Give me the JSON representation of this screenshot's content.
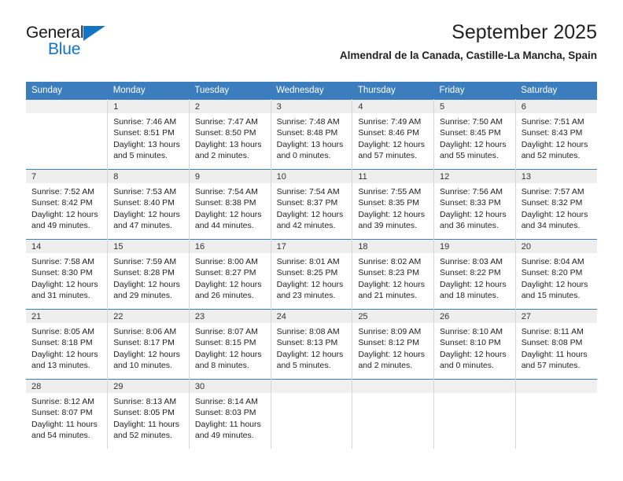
{
  "brand": {
    "line1": "General",
    "line2": "Blue",
    "triangle_icon": "triangle-icon",
    "colors": {
      "accent": "#1275c4"
    }
  },
  "header": {
    "title": "September 2025",
    "subtitle": "Almendral de la Canada, Castille-La Mancha, Spain"
  },
  "colors": {
    "header_bg": "#3b7dbd",
    "header_text": "#ffffff",
    "date_strip_bg": "#eeeeee",
    "cell_bg": "#ffffff",
    "rule": "#3b7dbd"
  },
  "calendar": {
    "weekday_headers": [
      "Sunday",
      "Monday",
      "Tuesday",
      "Wednesday",
      "Thursday",
      "Friday",
      "Saturday"
    ],
    "weeks": [
      [
        {
          "date": "",
          "sunrise": "",
          "sunset": "",
          "daylight_line1": "",
          "daylight_line2": ""
        },
        {
          "date": "1",
          "sunrise": "Sunrise: 7:46 AM",
          "sunset": "Sunset: 8:51 PM",
          "daylight_line1": "Daylight: 13 hours",
          "daylight_line2": "and 5 minutes."
        },
        {
          "date": "2",
          "sunrise": "Sunrise: 7:47 AM",
          "sunset": "Sunset: 8:50 PM",
          "daylight_line1": "Daylight: 13 hours",
          "daylight_line2": "and 2 minutes."
        },
        {
          "date": "3",
          "sunrise": "Sunrise: 7:48 AM",
          "sunset": "Sunset: 8:48 PM",
          "daylight_line1": "Daylight: 13 hours",
          "daylight_line2": "and 0 minutes."
        },
        {
          "date": "4",
          "sunrise": "Sunrise: 7:49 AM",
          "sunset": "Sunset: 8:46 PM",
          "daylight_line1": "Daylight: 12 hours",
          "daylight_line2": "and 57 minutes."
        },
        {
          "date": "5",
          "sunrise": "Sunrise: 7:50 AM",
          "sunset": "Sunset: 8:45 PM",
          "daylight_line1": "Daylight: 12 hours",
          "daylight_line2": "and 55 minutes."
        },
        {
          "date": "6",
          "sunrise": "Sunrise: 7:51 AM",
          "sunset": "Sunset: 8:43 PM",
          "daylight_line1": "Daylight: 12 hours",
          "daylight_line2": "and 52 minutes."
        }
      ],
      [
        {
          "date": "7",
          "sunrise": "Sunrise: 7:52 AM",
          "sunset": "Sunset: 8:42 PM",
          "daylight_line1": "Daylight: 12 hours",
          "daylight_line2": "and 49 minutes."
        },
        {
          "date": "8",
          "sunrise": "Sunrise: 7:53 AM",
          "sunset": "Sunset: 8:40 PM",
          "daylight_line1": "Daylight: 12 hours",
          "daylight_line2": "and 47 minutes."
        },
        {
          "date": "9",
          "sunrise": "Sunrise: 7:54 AM",
          "sunset": "Sunset: 8:38 PM",
          "daylight_line1": "Daylight: 12 hours",
          "daylight_line2": "and 44 minutes."
        },
        {
          "date": "10",
          "sunrise": "Sunrise: 7:54 AM",
          "sunset": "Sunset: 8:37 PM",
          "daylight_line1": "Daylight: 12 hours",
          "daylight_line2": "and 42 minutes."
        },
        {
          "date": "11",
          "sunrise": "Sunrise: 7:55 AM",
          "sunset": "Sunset: 8:35 PM",
          "daylight_line1": "Daylight: 12 hours",
          "daylight_line2": "and 39 minutes."
        },
        {
          "date": "12",
          "sunrise": "Sunrise: 7:56 AM",
          "sunset": "Sunset: 8:33 PM",
          "daylight_line1": "Daylight: 12 hours",
          "daylight_line2": "and 36 minutes."
        },
        {
          "date": "13",
          "sunrise": "Sunrise: 7:57 AM",
          "sunset": "Sunset: 8:32 PM",
          "daylight_line1": "Daylight: 12 hours",
          "daylight_line2": "and 34 minutes."
        }
      ],
      [
        {
          "date": "14",
          "sunrise": "Sunrise: 7:58 AM",
          "sunset": "Sunset: 8:30 PM",
          "daylight_line1": "Daylight: 12 hours",
          "daylight_line2": "and 31 minutes."
        },
        {
          "date": "15",
          "sunrise": "Sunrise: 7:59 AM",
          "sunset": "Sunset: 8:28 PM",
          "daylight_line1": "Daylight: 12 hours",
          "daylight_line2": "and 29 minutes."
        },
        {
          "date": "16",
          "sunrise": "Sunrise: 8:00 AM",
          "sunset": "Sunset: 8:27 PM",
          "daylight_line1": "Daylight: 12 hours",
          "daylight_line2": "and 26 minutes."
        },
        {
          "date": "17",
          "sunrise": "Sunrise: 8:01 AM",
          "sunset": "Sunset: 8:25 PM",
          "daylight_line1": "Daylight: 12 hours",
          "daylight_line2": "and 23 minutes."
        },
        {
          "date": "18",
          "sunrise": "Sunrise: 8:02 AM",
          "sunset": "Sunset: 8:23 PM",
          "daylight_line1": "Daylight: 12 hours",
          "daylight_line2": "and 21 minutes."
        },
        {
          "date": "19",
          "sunrise": "Sunrise: 8:03 AM",
          "sunset": "Sunset: 8:22 PM",
          "daylight_line1": "Daylight: 12 hours",
          "daylight_line2": "and 18 minutes."
        },
        {
          "date": "20",
          "sunrise": "Sunrise: 8:04 AM",
          "sunset": "Sunset: 8:20 PM",
          "daylight_line1": "Daylight: 12 hours",
          "daylight_line2": "and 15 minutes."
        }
      ],
      [
        {
          "date": "21",
          "sunrise": "Sunrise: 8:05 AM",
          "sunset": "Sunset: 8:18 PM",
          "daylight_line1": "Daylight: 12 hours",
          "daylight_line2": "and 13 minutes."
        },
        {
          "date": "22",
          "sunrise": "Sunrise: 8:06 AM",
          "sunset": "Sunset: 8:17 PM",
          "daylight_line1": "Daylight: 12 hours",
          "daylight_line2": "and 10 minutes."
        },
        {
          "date": "23",
          "sunrise": "Sunrise: 8:07 AM",
          "sunset": "Sunset: 8:15 PM",
          "daylight_line1": "Daylight: 12 hours",
          "daylight_line2": "and 8 minutes."
        },
        {
          "date": "24",
          "sunrise": "Sunrise: 8:08 AM",
          "sunset": "Sunset: 8:13 PM",
          "daylight_line1": "Daylight: 12 hours",
          "daylight_line2": "and 5 minutes."
        },
        {
          "date": "25",
          "sunrise": "Sunrise: 8:09 AM",
          "sunset": "Sunset: 8:12 PM",
          "daylight_line1": "Daylight: 12 hours",
          "daylight_line2": "and 2 minutes."
        },
        {
          "date": "26",
          "sunrise": "Sunrise: 8:10 AM",
          "sunset": "Sunset: 8:10 PM",
          "daylight_line1": "Daylight: 12 hours",
          "daylight_line2": "and 0 minutes."
        },
        {
          "date": "27",
          "sunrise": "Sunrise: 8:11 AM",
          "sunset": "Sunset: 8:08 PM",
          "daylight_line1": "Daylight: 11 hours",
          "daylight_line2": "and 57 minutes."
        }
      ],
      [
        {
          "date": "28",
          "sunrise": "Sunrise: 8:12 AM",
          "sunset": "Sunset: 8:07 PM",
          "daylight_line1": "Daylight: 11 hours",
          "daylight_line2": "and 54 minutes."
        },
        {
          "date": "29",
          "sunrise": "Sunrise: 8:13 AM",
          "sunset": "Sunset: 8:05 PM",
          "daylight_line1": "Daylight: 11 hours",
          "daylight_line2": "and 52 minutes."
        },
        {
          "date": "30",
          "sunrise": "Sunrise: 8:14 AM",
          "sunset": "Sunset: 8:03 PM",
          "daylight_line1": "Daylight: 11 hours",
          "daylight_line2": "and 49 minutes."
        },
        {
          "date": "",
          "sunrise": "",
          "sunset": "",
          "daylight_line1": "",
          "daylight_line2": ""
        },
        {
          "date": "",
          "sunrise": "",
          "sunset": "",
          "daylight_line1": "",
          "daylight_line2": ""
        },
        {
          "date": "",
          "sunrise": "",
          "sunset": "",
          "daylight_line1": "",
          "daylight_line2": ""
        },
        {
          "date": "",
          "sunrise": "",
          "sunset": "",
          "daylight_line1": "",
          "daylight_line2": ""
        }
      ]
    ]
  }
}
